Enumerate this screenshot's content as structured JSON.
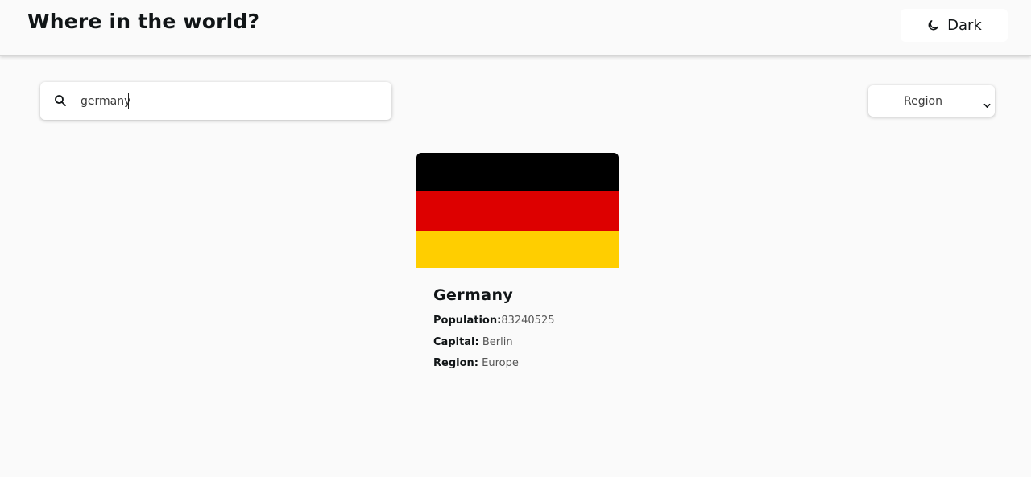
{
  "header": {
    "title": "Where in the world?",
    "theme_toggle_label": "Dark",
    "theme_toggle_icon": "moon-icon"
  },
  "search": {
    "value": "germany",
    "placeholder": "",
    "icon": "search-icon"
  },
  "filter": {
    "selected": "Region",
    "icon": "chevron-down-icon"
  },
  "countries": [
    {
      "name": "Germany",
      "flag_colors": [
        "#000000",
        "#dd0000",
        "#ffce00"
      ],
      "population_label": "Population:",
      "population": "83240525",
      "capital_label": "Capital:",
      "capital": "Berlin",
      "region_label": "Region:",
      "region": "Europe"
    }
  ]
}
